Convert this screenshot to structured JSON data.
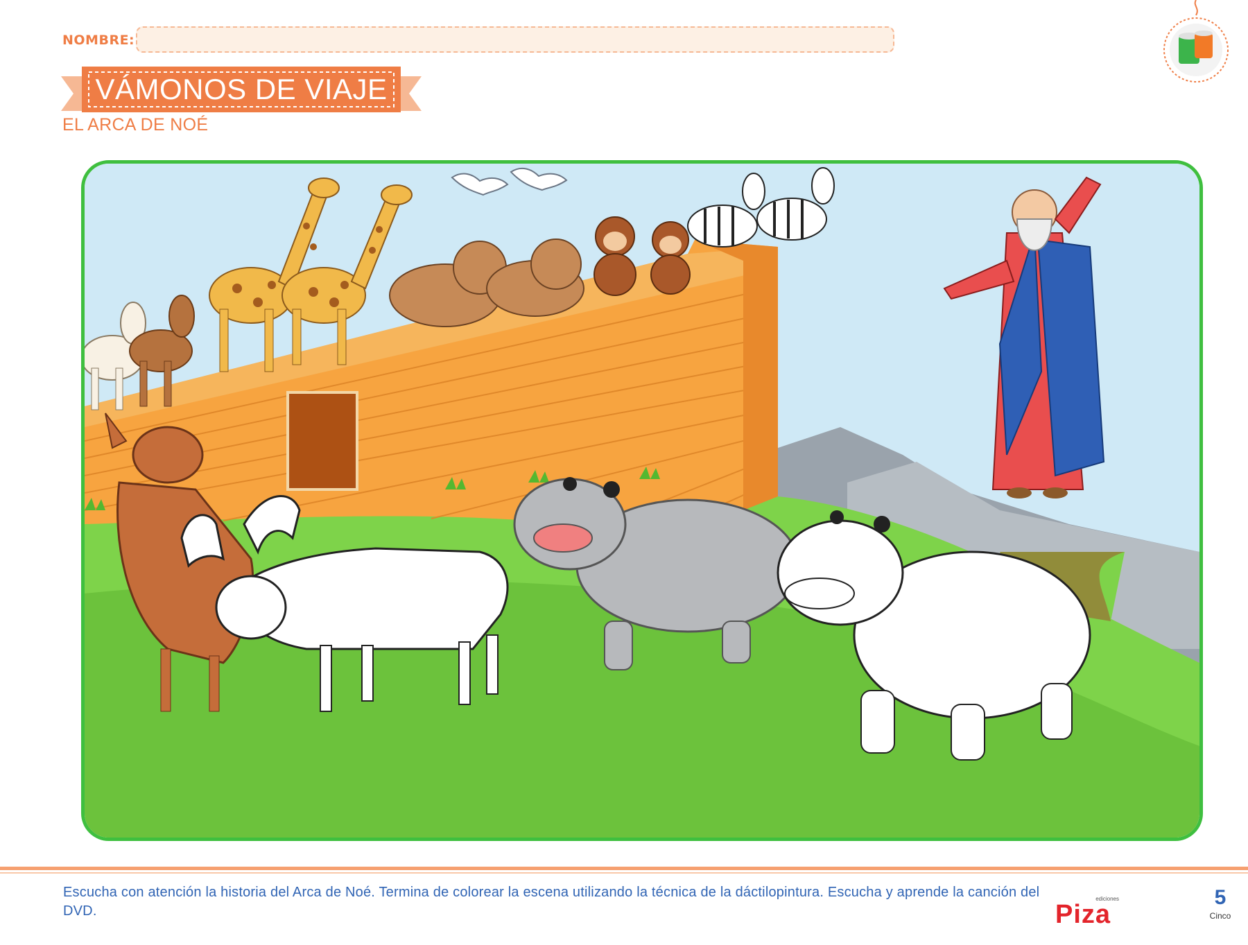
{
  "header": {
    "name_label": "NOMBRE:",
    "name_value": "",
    "title": "VÁMONOS DE VIAJE",
    "subtitle": "EL ARCA DE NOÉ",
    "badge_icon": "paint-pots-icon"
  },
  "scene": {
    "description_icons": [
      "ark-icon",
      "noah-icon",
      "giraffe-icon",
      "zebra-icon",
      "horse-icon",
      "bear-icon",
      "monkey-icon",
      "seagull-icon",
      "deer-icon",
      "moose-icon",
      "hippo-icon"
    ]
  },
  "footer": {
    "instructions": "Escucha con atención la historia del Arca de Noé. Termina de colorear la escena utilizando la técnica de la dáctilopintura. Escucha y aprende la canción del DVD.",
    "logo_small": "ediciones",
    "logo_main": "Piza",
    "page_number": "5",
    "page_word": "Cinco"
  },
  "colors": {
    "accent": "#ef7d45",
    "frame": "#3fbf3f",
    "text_blue": "#3064b4",
    "brand_red": "#e3242b"
  }
}
